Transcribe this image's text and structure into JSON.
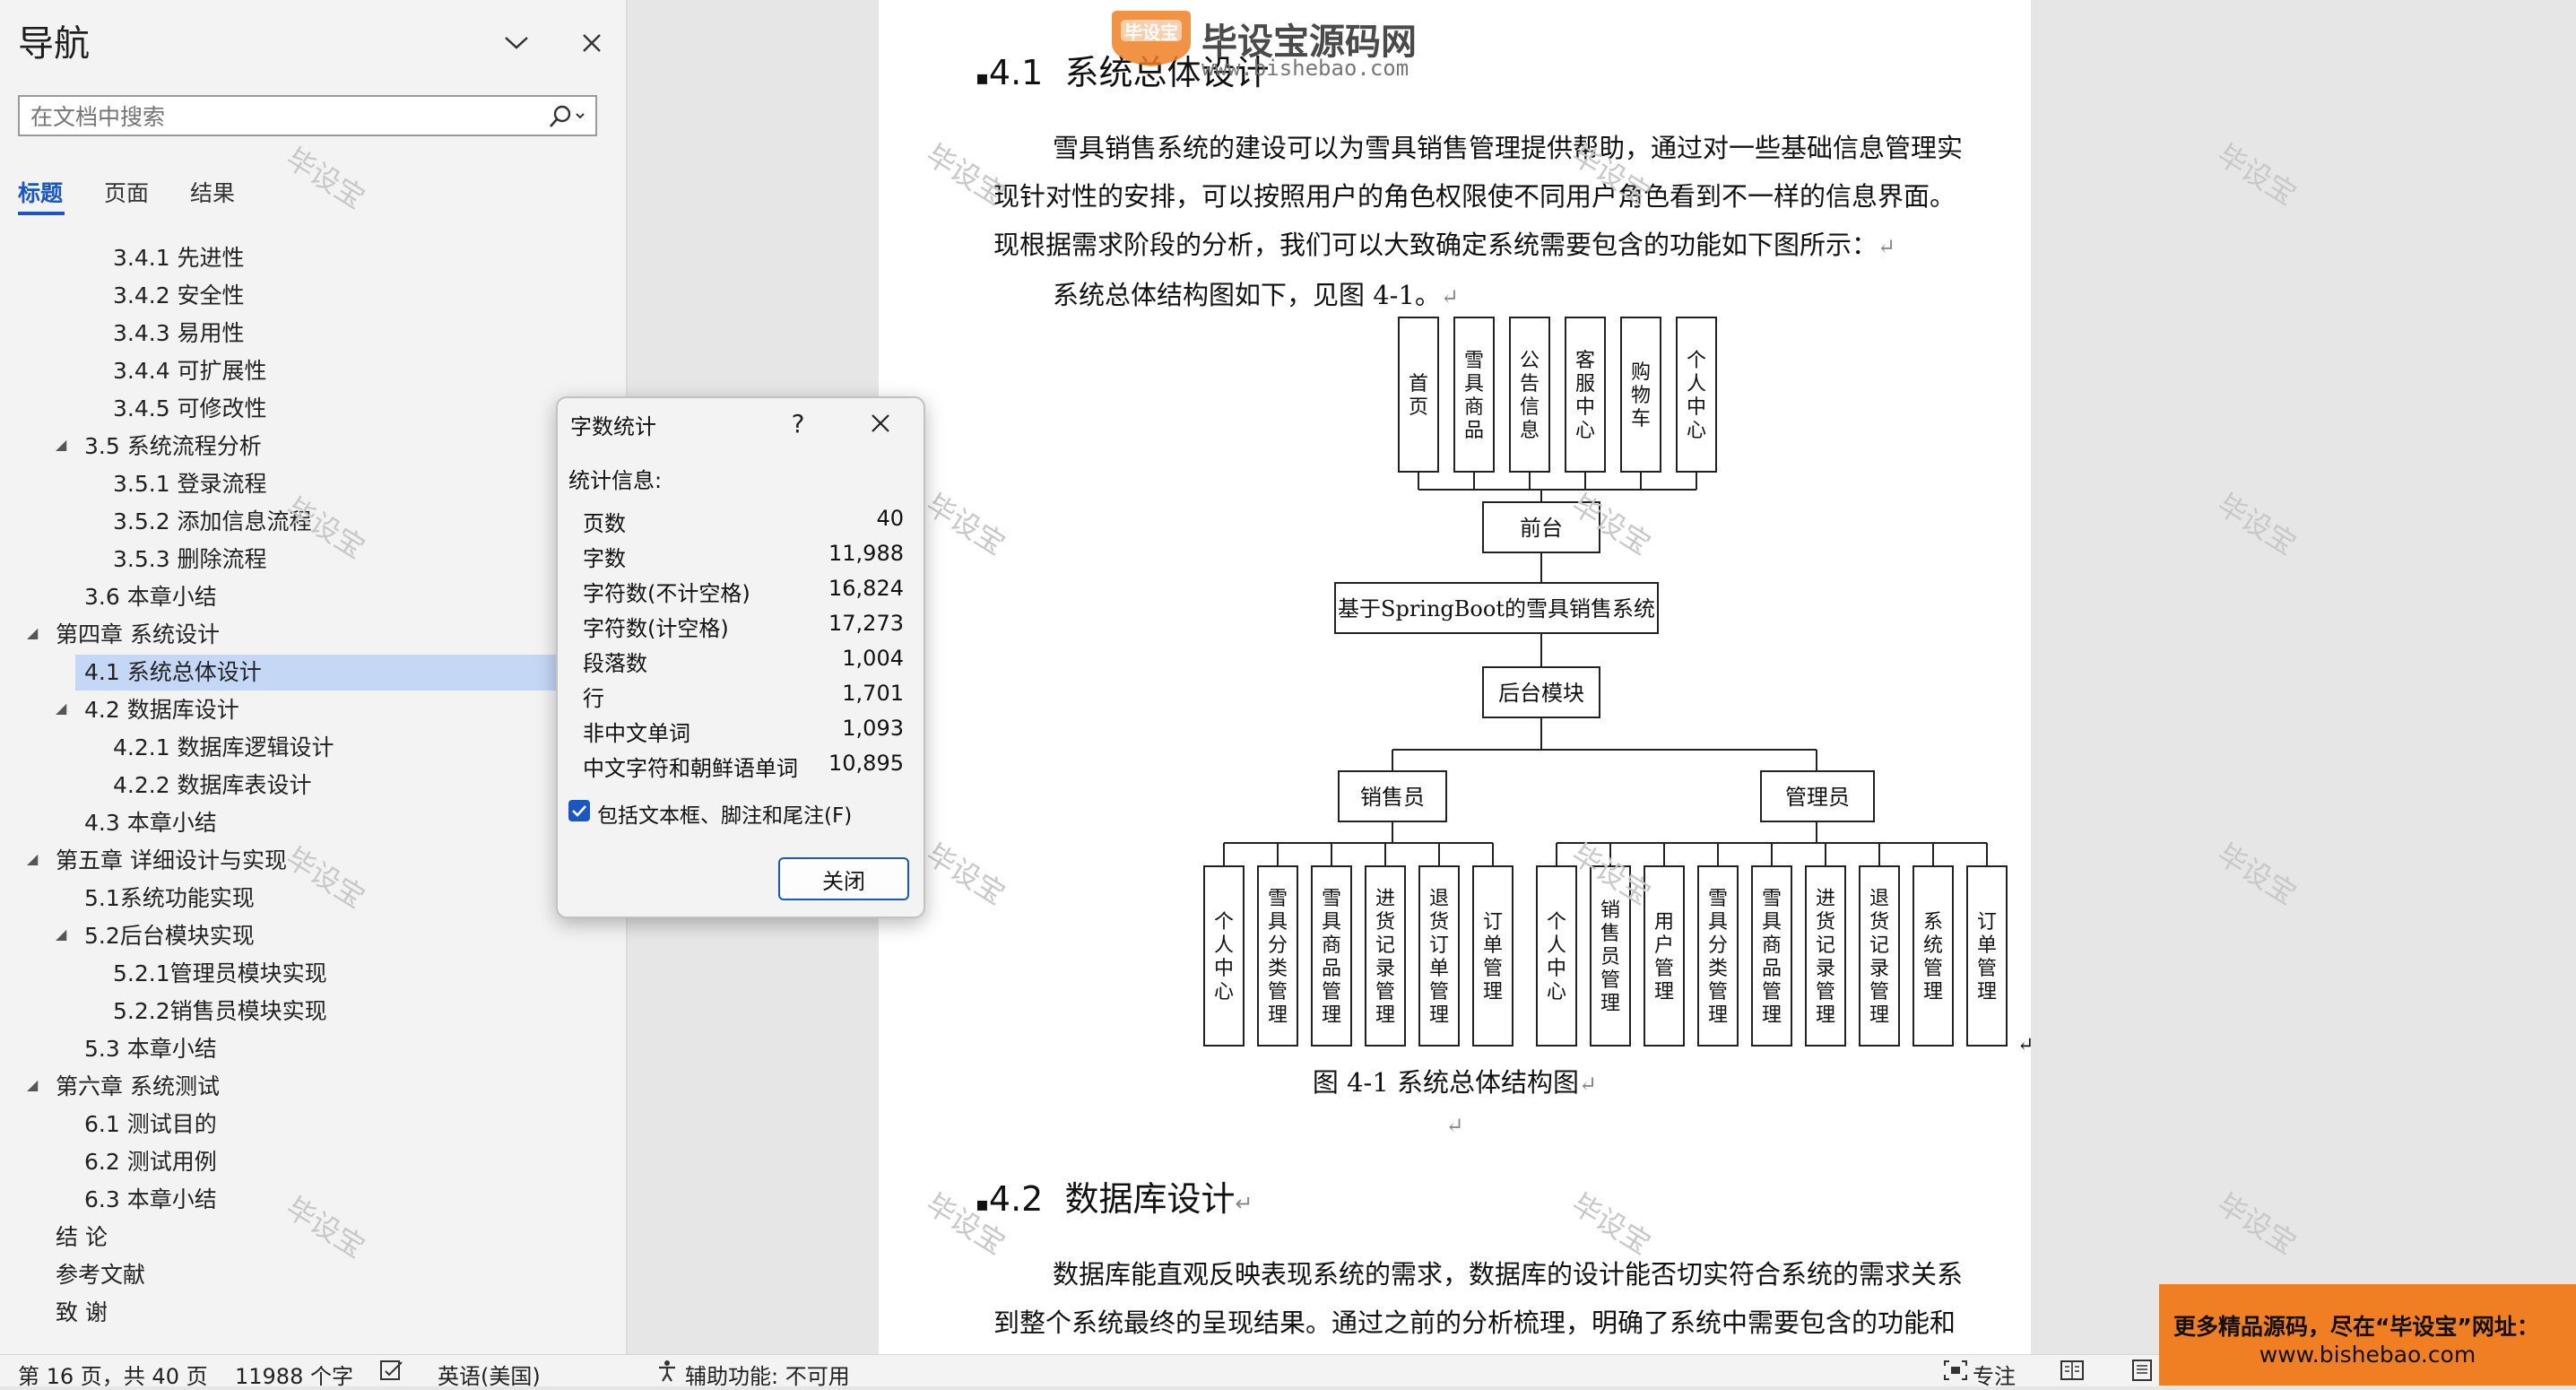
{
  "nav": {
    "title": "导航",
    "search_placeholder": "在文档中搜索",
    "tabs": [
      "标题",
      "页面",
      "结果"
    ],
    "tree": [
      {
        "label": "3.4.1 先进性",
        "level": 3
      },
      {
        "label": "3.4.2 安全性",
        "level": 3
      },
      {
        "label": "3.4.3 易用性",
        "level": 3
      },
      {
        "label": "3.4.4 可扩展性",
        "level": 3
      },
      {
        "label": "3.4.5 可修改性",
        "level": 3
      },
      {
        "label": "3.5 系统流程分析",
        "level": 2,
        "expanded": true
      },
      {
        "label": "3.5.1 登录流程",
        "level": 3
      },
      {
        "label": "3.5.2 添加信息流程",
        "level": 3
      },
      {
        "label": "3.5.3 删除流程",
        "level": 3
      },
      {
        "label": "3.6 本章小结",
        "level": 2
      },
      {
        "label": "第四章 系统设计",
        "level": 1,
        "expanded": true
      },
      {
        "label": "4.1 系统总体设计",
        "level": 2,
        "selected": true
      },
      {
        "label": "4.2 数据库设计",
        "level": 2,
        "expanded": true
      },
      {
        "label": "4.2.1 数据库逻辑设计",
        "level": 3
      },
      {
        "label": "4.2.2 数据库表设计",
        "level": 3
      },
      {
        "label": "4.3 本章小结",
        "level": 2
      },
      {
        "label": "第五章 详细设计与实现",
        "level": 1,
        "expanded": true
      },
      {
        "label": "5.1系统功能实现",
        "level": 2
      },
      {
        "label": "5.2后台模块实现",
        "level": 2,
        "expanded": true
      },
      {
        "label": "5.2.1管理员模块实现",
        "level": 3
      },
      {
        "label": "5.2.2销售员模块实现",
        "level": 3
      },
      {
        "label": "5.3 本章小结",
        "level": 2
      },
      {
        "label": "第六章 系统测试",
        "level": 1,
        "expanded": true
      },
      {
        "label": "6.1 测试目的",
        "level": 2
      },
      {
        "label": "6.2 测试用例",
        "level": 2
      },
      {
        "label": "6.3 本章小结",
        "level": 2
      },
      {
        "label": "结  论",
        "level": 1
      },
      {
        "label": "参考文献",
        "level": 1
      },
      {
        "label": "致  谢",
        "level": 1
      }
    ]
  },
  "dialog": {
    "title": "字数统计",
    "help": "?",
    "stats_label": "统计信息:",
    "stats": [
      {
        "label": "页数",
        "value": "40"
      },
      {
        "label": "字数",
        "value": "11,988"
      },
      {
        "label": "字符数(不计空格)",
        "value": "16,824"
      },
      {
        "label": "字符数(计空格)",
        "value": "17,273"
      },
      {
        "label": "段落数",
        "value": "1,004"
      },
      {
        "label": "行",
        "value": "1,701"
      },
      {
        "label": "非中文单词",
        "value": "1,093"
      },
      {
        "label": "中文字符和朝鲜语单词",
        "value": "10,895"
      }
    ],
    "checkbox_label": "包括文本框、脚注和尾注(F)",
    "close_label": "关闭"
  },
  "doc": {
    "heading1_num": "4.1",
    "heading1_text": "系统总体设计",
    "para1_lines": [
      "雪具销售系统的建设可以为雪具销售管理提供帮助，通过对一些基础信息管理实",
      "现针对性的安排，可以按照用户的角色权限使不同用户角色看到不一样的信息界面。",
      "现根据需求阶段的分析，我们可以大致确定系统需要包含的功能如下图所示：",
      "系统总体结构图如下，见图 4-1。"
    ],
    "return_mark": "↵",
    "figure_caption": "图 4-1  系统总体结构图",
    "heading2_num": "4.2",
    "heading2_text": "数据库设计",
    "para2_lines": [
      "数据库能直观反映表现系统的需求，数据库的设计能否切实符合系统的需求关系",
      "到整个系统最终的呈现结果。通过之前的分析梳理，明确了系统中需要包含的功能和"
    ]
  },
  "diagram": {
    "front_modules": [
      "首页",
      "雪具商品",
      "公告信息",
      "客服中心",
      "购物车",
      "个人中心"
    ],
    "front_node": "前台",
    "system_node": "基于SpringBoot的雪具销售系统",
    "backend_node": "后台模块",
    "role_sales": "销售员",
    "role_admin": "管理员",
    "sales_modules": [
      "个人中心",
      "雪具分类管理",
      "雪具商品管理",
      "进货记录管理",
      "退货订单管理",
      "订单管理"
    ],
    "admin_modules": [
      "个人中心",
      "销售员管理",
      "用户管理",
      "雪具分类管理",
      "雪具商品管理",
      "进货记录管理",
      "退货记录管理",
      "系统管理",
      "订单管理"
    ]
  },
  "watermark": {
    "text": "毕设宝",
    "logo_badge": "毕设宝",
    "logo_title": "毕设宝源码网",
    "logo_url": "www.bishebao.com"
  },
  "status": {
    "page": "第 16 页，共 40 页",
    "words": "11988 个字",
    "language": "英语(美国)",
    "accessibility": "辅助功能: 不可用",
    "focus": "专注"
  },
  "promo": {
    "line1": "更多精品源码，尽在“毕设宝”网址：",
    "line2": "www.bishebao.com"
  },
  "colors": {
    "accent": "#1a56c4",
    "selection": "#c4d7f5",
    "promo": "#f07f24"
  }
}
